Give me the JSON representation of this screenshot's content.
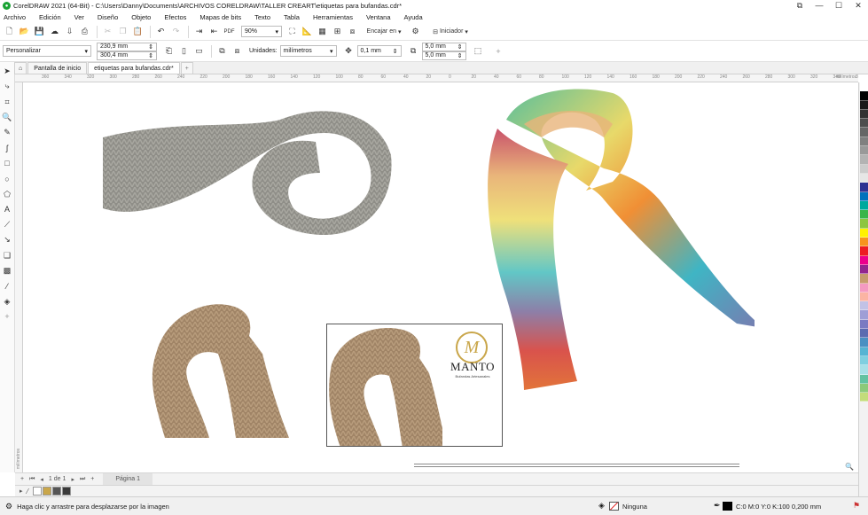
{
  "window": {
    "title": "CorelDRAW 2021 (64-Bit) - C:\\Users\\Danny\\Documents\\ARCHIVOS CORELDRAW\\TALLER CREART\\etiquetas para bufandas.cdr*",
    "minimize": "—",
    "maximize": "☐",
    "close": "✕"
  },
  "menu": [
    "Archivo",
    "Edición",
    "Ver",
    "Diseño",
    "Objeto",
    "Efectos",
    "Mapas de bits",
    "Texto",
    "Tabla",
    "Herramientas",
    "Ventana",
    "Ayuda"
  ],
  "toolbar1": {
    "zoom": "90%",
    "snap_label": "Encajar en",
    "launch_label": "Iniciador"
  },
  "toolbar2": {
    "preset": "Personalizar",
    "width": "230,9 mm",
    "height": "300,4 mm",
    "units_label": "Unidades:",
    "units_value": "milímetros",
    "nudge": "0,1 mm",
    "dup_x": "5,0 mm",
    "dup_y": "5,0 mm"
  },
  "tabs": {
    "home": "Pantalla de inicio",
    "doc": "etiquetas para bufandas.cdr*"
  },
  "ruler": {
    "units": "milímetros",
    "h_ticks": [
      "360",
      "340",
      "320",
      "300",
      "280",
      "260",
      "240",
      "220",
      "200",
      "180",
      "160",
      "140",
      "120",
      "100",
      "80",
      "60",
      "40",
      "20",
      "0",
      "20",
      "40",
      "60",
      "80",
      "100",
      "120",
      "140",
      "160",
      "180",
      "200",
      "220",
      "240",
      "260",
      "280",
      "300",
      "320",
      "340",
      "360"
    ],
    "v_label": "milímetros"
  },
  "label": {
    "monogram": "M",
    "brand": "MANTO",
    "tagline": "Bufandas Artesanales"
  },
  "pagebar": {
    "current": "1",
    "of": "de",
    "total": "1",
    "page_tab": "Página 1"
  },
  "status": {
    "hint": "Haga clic y arrastre para desplazarse por la imagen",
    "fill": "Ninguna",
    "outline": "C:0 M:0 Y:0 K:100  0,200 mm"
  },
  "colors": {
    "palette": [
      "#ffffff",
      "#000000",
      "#1a1a1a",
      "#333333",
      "#4d4d4d",
      "#666666",
      "#808080",
      "#999999",
      "#b3b3b3",
      "#cccccc",
      "#e6e6e6",
      "#2e3192",
      "#0071bc",
      "#00a99d",
      "#39b54a",
      "#8cc63f",
      "#fff200",
      "#f7941d",
      "#ed1c24",
      "#ec008c",
      "#92278f",
      "#c69c6d",
      "#f49ac1",
      "#fbb4a3",
      "#c2c2e6",
      "#9e9ed6",
      "#7a7ac2",
      "#5b6bb0",
      "#4a90c2",
      "#56b4d3",
      "#7fcfe0",
      "#a8e0e8",
      "#62c2a2",
      "#8cc97a",
      "#c3dc7a"
    ],
    "doc_palette": [
      "#ffffff",
      "#c9a64a",
      "#555555",
      "#3a3a3a"
    ]
  }
}
